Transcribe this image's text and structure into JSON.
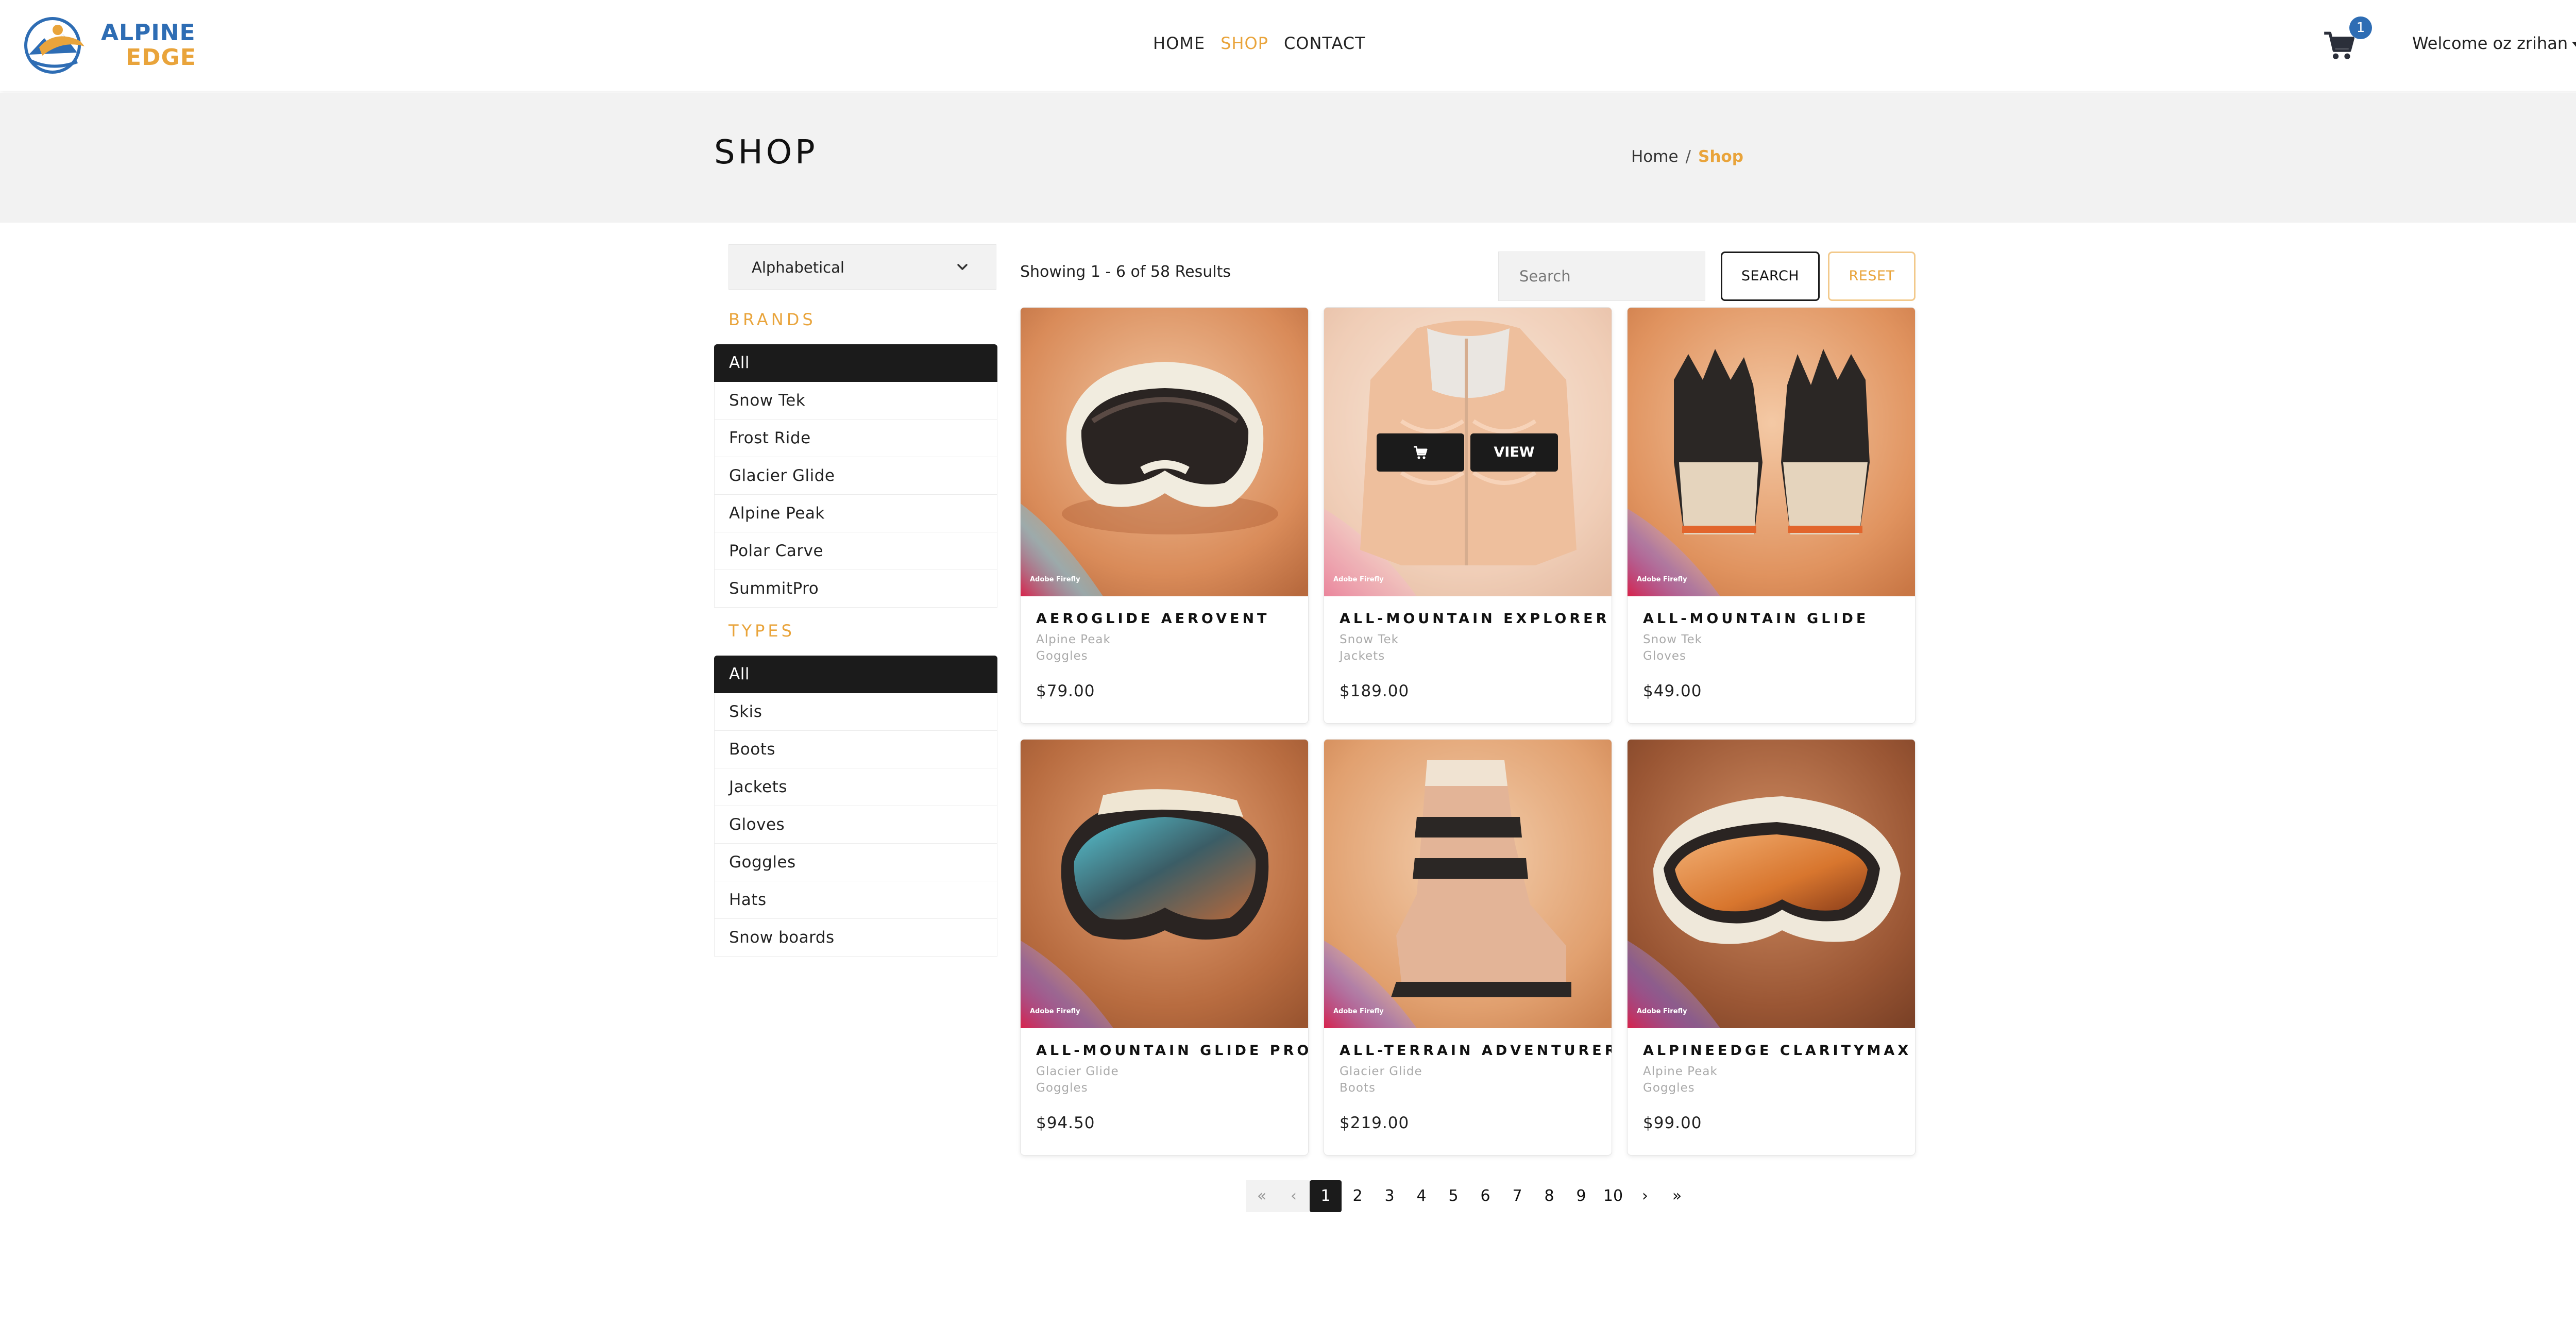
{
  "brand": {
    "line1": "ALPINE",
    "line2": "EDGE"
  },
  "nav": {
    "home": "HOME",
    "shop": "SHOP",
    "contact": "CONTACT"
  },
  "cart": {
    "count": "1"
  },
  "user": {
    "welcome": "Welcome oz zrihan"
  },
  "header": {
    "title": "SHOP",
    "breadcrumb_home": "Home",
    "breadcrumb_sep": "/",
    "breadcrumb_current": "Shop"
  },
  "sort": {
    "selected": "Alphabetical"
  },
  "brands": {
    "title": "BRANDS",
    "items": [
      "All",
      "Snow Tek",
      "Frost Ride",
      "Glacier Glide",
      "Alpine Peak",
      "Polar Carve",
      "SummitPro"
    ]
  },
  "types": {
    "title": "TYPES",
    "items": [
      "All",
      "Skis",
      "Boots",
      "Jackets",
      "Gloves",
      "Goggles",
      "Hats",
      "Snow boards"
    ]
  },
  "results": {
    "summary": "Showing 1 - 6 of 58 Results"
  },
  "search": {
    "placeholder": "Search",
    "button": "SEARCH",
    "reset": "RESET"
  },
  "products": [
    {
      "name": "AEROGLIDE AEROVENT",
      "brand": "Alpine Peak",
      "type": "Goggles",
      "price": "$79.00",
      "image": "goggles"
    },
    {
      "name": "ALL-MOUNTAIN EXPLORER",
      "brand": "Snow Tek",
      "type": "Jackets",
      "price": "$189.00",
      "image": "jacket"
    },
    {
      "name": "ALL-MOUNTAIN GLIDE",
      "brand": "Snow Tek",
      "type": "Gloves",
      "price": "$49.00",
      "image": "gloves"
    },
    {
      "name": "ALL-MOUNTAIN GLIDE PRO",
      "brand": "Glacier Glide",
      "type": "Goggles",
      "price": "$94.50",
      "image": "goggles-teal"
    },
    {
      "name": "ALL-TERRAIN ADVENTURER",
      "brand": "Glacier Glide",
      "type": "Boots",
      "price": "$219.00",
      "image": "boot"
    },
    {
      "name": "ALPINEEDGE CLARITYMAX",
      "brand": "Alpine Peak",
      "type": "Goggles",
      "price": "$99.00",
      "image": "goggles-orange"
    }
  ],
  "card_hover": {
    "view": "VIEW"
  },
  "image_badge": "Adobe Firefly",
  "pagination": {
    "first": "«",
    "prev": "‹",
    "pages": [
      "1",
      "2",
      "3",
      "4",
      "5",
      "6",
      "7",
      "8",
      "9",
      "10"
    ],
    "current": "1",
    "next": "›",
    "last": "»"
  },
  "colors": {
    "accent": "#e9a43b",
    "brand_blue": "#2e6db4",
    "dark": "#1b1b1b"
  }
}
